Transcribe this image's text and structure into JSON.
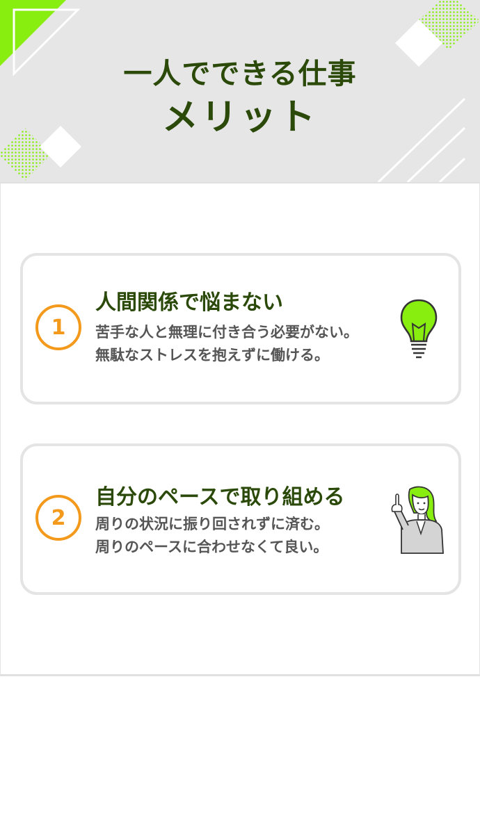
{
  "header": {
    "title_line1": "一人でできる仕事",
    "title_line2": "メリット"
  },
  "colors": {
    "accent_green": "#88ee0f",
    "title_green": "#2b4a0a",
    "number_orange": "#f39a1c",
    "header_gray": "#e6e6e6"
  },
  "merits": [
    {
      "number": "1",
      "title": "人間関係で悩まない",
      "desc_line1": "苦手な人と無理に付き合う必要がない。",
      "desc_line2": "無駄なストレスを抱えずに働ける。",
      "illustration": "lightbulb-icon"
    },
    {
      "number": "2",
      "title": "自分のペースで取り組める",
      "desc_line1": "周りの状況に振り回されずに済む。",
      "desc_line2": "周りのペースに合わせなくて良い。",
      "illustration": "pointing-woman-illustration"
    }
  ]
}
